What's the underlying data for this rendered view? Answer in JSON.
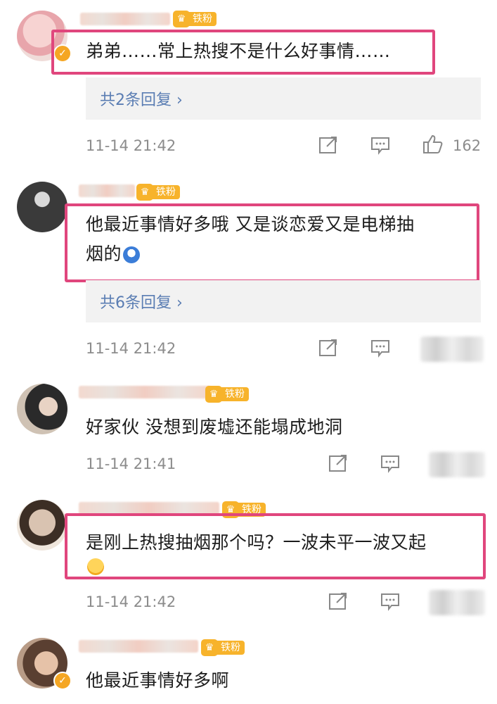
{
  "comments": [
    {
      "text": "弟弟……常上热搜不是什么好事情……",
      "badge": "铁粉",
      "replies": "共2条回复 ›",
      "time": "11-14 21:42",
      "likes": "162",
      "verified_icon": "verified-badge-icon",
      "avatar_colors": [
        "#f2c8c9",
        "#e59ea4"
      ]
    },
    {
      "text_line1": "他最近事情好多哦 又是谈恋爱又是电梯抽",
      "text_line2": "烟的",
      "badge": "铁粉",
      "replies": "共6条回复 ›",
      "time": "11-14 21:42",
      "avatar_colors": [
        "#404040",
        "#1a1a1a"
      ]
    },
    {
      "text": "好家伙 没想到废墟还能塌成地洞",
      "badge": "铁粉",
      "time": "11-14 21:41",
      "avatar_colors": [
        "#c9b9a6",
        "#2c2c2c"
      ]
    },
    {
      "text": "是刚上热搜抽烟那个吗？一波未平一波又起",
      "badge": "铁粉",
      "time": "11-14 21:42",
      "avatar_colors": [
        "#c7b3a0",
        "#6d5a4b"
      ]
    },
    {
      "text": "他最近事情好多啊",
      "badge": "铁粉",
      "verified_icon": "verified-badge-icon",
      "avatar_colors": [
        "#6a4f40",
        "#d8b49c"
      ]
    }
  ],
  "colors": {
    "highlight": "#e0467d",
    "badge": "#f7b32b",
    "replies_text": "#5a7db3",
    "meta_text": "#8c8c8c"
  },
  "icons": [
    "share-icon",
    "comment-icon",
    "like-icon",
    "verified-badge-icon",
    "crown-icon",
    "emoji-icon"
  ]
}
